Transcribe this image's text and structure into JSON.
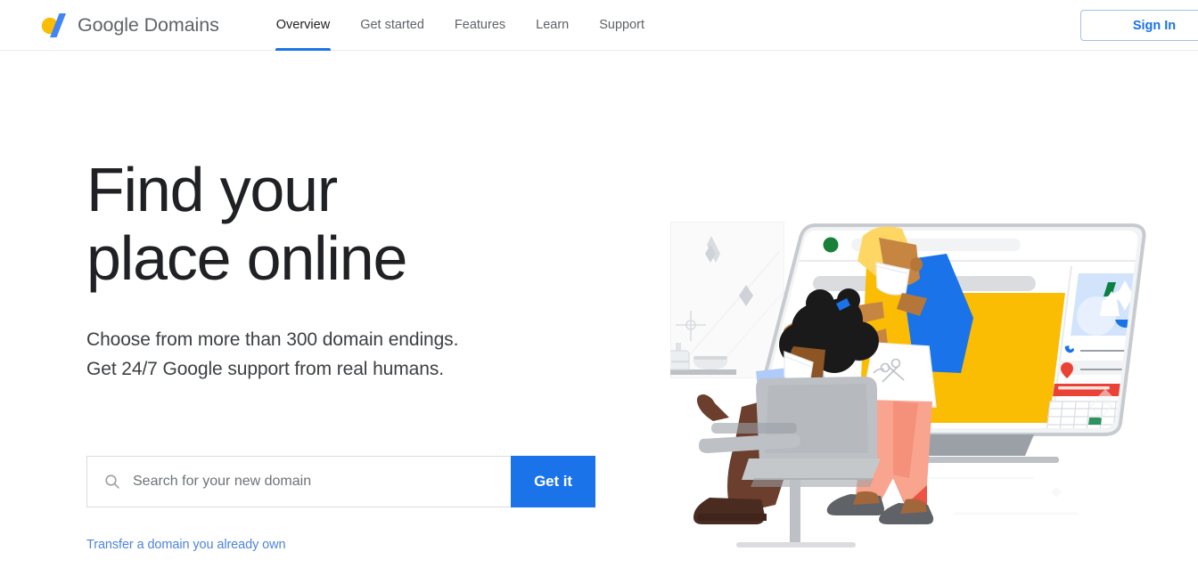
{
  "header": {
    "brand": {
      "logo_icon": "google-domains-logo-icon",
      "name_part1": "Google",
      "name_part2": "Domains",
      "logo_colors": {
        "circle": "#fbbc04",
        "slash": "#4285f4"
      }
    },
    "nav": [
      {
        "label": "Overview",
        "active": true
      },
      {
        "label": "Get started",
        "active": false
      },
      {
        "label": "Features",
        "active": false
      },
      {
        "label": "Learn",
        "active": false
      },
      {
        "label": "Support",
        "active": false
      }
    ],
    "signin_label": "Sign In",
    "accent_color": "#1a73e8"
  },
  "hero": {
    "headline_line1": "Find your",
    "headline_line2": "place online",
    "subhead_line1": "Choose from more than 300 domain endings.",
    "subhead_line2": "Get 24/7 Google support from real humans.",
    "search": {
      "icon": "search-icon",
      "placeholder": "Search for your new domain",
      "value": "",
      "button_label": "Get it"
    },
    "transfer_link_label": "Transfer a domain you already own"
  },
  "illustration": {
    "name": "salon-hairdresser-illustration",
    "description": "A hair stylist wearing a face mask combs a seated client's hair in front of a large desktop monitor showing a salon website mockup",
    "palette": {
      "monitor_frame": "#dadce0",
      "monitor_screen": "#ffffff",
      "status_dot_green": "#188038",
      "accent_yellow": "#fbbc04",
      "accent_blue": "#1a73e8",
      "accent_red": "#ea4335",
      "skin_dark": "#8d5524",
      "skin_light": "#c68642",
      "pants_pink": "#f8a48f",
      "hair_yellow": "#fdd663",
      "chair_grey": "#bdc1c6",
      "mirror_grey": "#f1f3f4"
    }
  }
}
